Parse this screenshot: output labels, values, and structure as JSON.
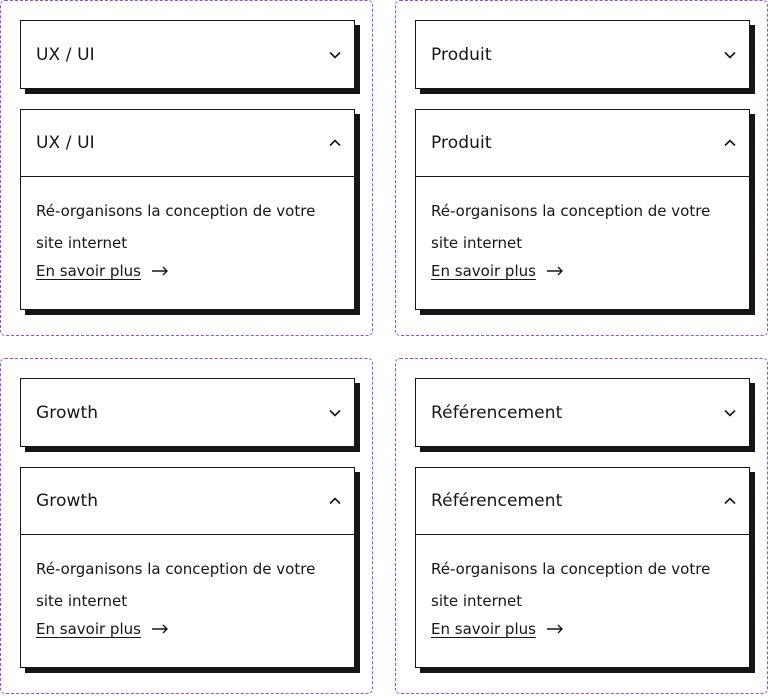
{
  "colors": {
    "text": "#161616",
    "border": "#161616",
    "group_outline": "#9747ff",
    "background": "#ffffff"
  },
  "icons": {
    "closed": "chevron-down-icon",
    "open": "chevron-up-icon",
    "link": "arrow-right-icon"
  },
  "accordions": [
    {
      "closed": {
        "title": "UX / UI"
      },
      "open": {
        "title": "UX / UI",
        "description": "Ré-organisons la conception de votre site internet",
        "link": "En savoir plus"
      }
    },
    {
      "closed": {
        "title": "Produit"
      },
      "open": {
        "title": "Produit",
        "description": "Ré-organisons la conception de votre site internet",
        "link": "En savoir plus"
      }
    },
    {
      "closed": {
        "title": "Growth"
      },
      "open": {
        "title": "Growth",
        "description": "Ré-organisons la conception de votre site internet",
        "link": "En savoir plus"
      }
    },
    {
      "closed": {
        "title": "Référencement"
      },
      "open": {
        "title": "Référencement",
        "description": "Ré-organisons la conception de votre site internet",
        "link": "En savoir plus"
      }
    }
  ]
}
